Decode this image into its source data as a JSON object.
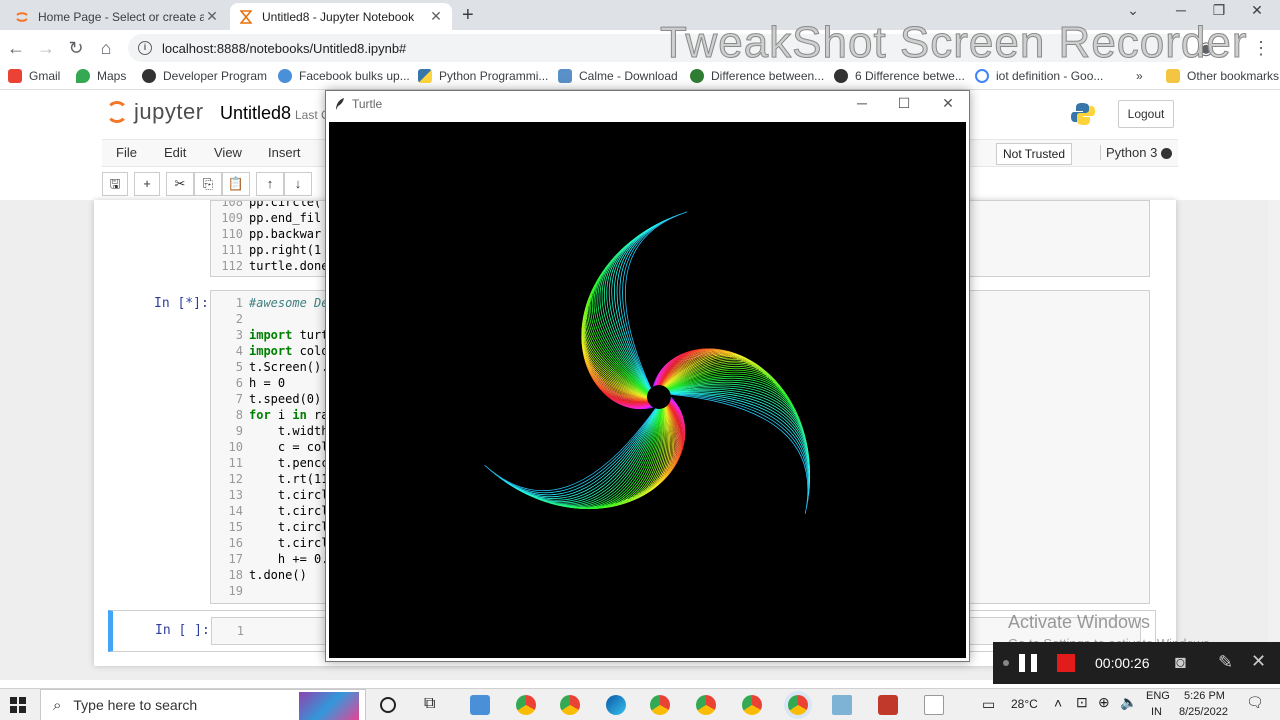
{
  "browser": {
    "tabs": [
      {
        "label": "Home Page - Select or create a n",
        "active": false
      },
      {
        "label": "Untitled8 - Jupyter Notebook",
        "active": true
      }
    ],
    "url": "localhost:8888/notebooks/Untitled8.ipynb#",
    "bookmarks": [
      "Gmail",
      "Maps",
      "Developer Program",
      "Facebook bulks up...",
      "Python Programmi...",
      "Calme - Download",
      "Difference between...",
      "6 Difference betwe...",
      "iot definition - Goo...",
      "»",
      "Other bookmarks"
    ],
    "watermark": "TweakShot Screen Recorder"
  },
  "jupyter": {
    "logo_text": "jupyter",
    "notebook_title": "Untitled8",
    "last_checkpoint": "Last C",
    "logout_label": "Logout",
    "menu": [
      "File",
      "Edit",
      "View",
      "Insert"
    ],
    "not_trusted": "Not Trusted",
    "kernel": "Python 3",
    "cell_top": {
      "lines": [
        {
          "n": "108",
          "code": "pp.circle("
        },
        {
          "n": "109",
          "code": "pp.end_fil"
        },
        {
          "n": "110",
          "code": "pp.backwar"
        },
        {
          "n": "111",
          "code": "pp.right(1"
        },
        {
          "n": "112",
          "code": "turtle.done"
        }
      ]
    },
    "cell_main": {
      "prompt": "In [*]:",
      "lines": [
        {
          "n": "1",
          "code": "#awesome De"
        },
        {
          "n": "2",
          "code": ""
        },
        {
          "n": "3",
          "code": "import turt"
        },
        {
          "n": "4",
          "code": "import colo"
        },
        {
          "n": "5",
          "code": "t.Screen()."
        },
        {
          "n": "6",
          "code": "h = 0"
        },
        {
          "n": "7",
          "code": "t.speed(0)"
        },
        {
          "n": "8",
          "code": "for i in ra"
        },
        {
          "n": "9",
          "code": "    t.width"
        },
        {
          "n": "10",
          "code": "    c = col"
        },
        {
          "n": "11",
          "code": "    t.pencc"
        },
        {
          "n": "12",
          "code": "    t.rt(11"
        },
        {
          "n": "13",
          "code": "    t.circl"
        },
        {
          "n": "14",
          "code": "    t.circl"
        },
        {
          "n": "15",
          "code": "    t.circl"
        },
        {
          "n": "16",
          "code": "    t.circl"
        },
        {
          "n": "17",
          "code": "    h += 0."
        },
        {
          "n": "18",
          "code": "t.done()"
        },
        {
          "n": "19",
          "code": ""
        }
      ]
    },
    "cell_empty": {
      "prompt": "In [ ]:",
      "line": "1"
    }
  },
  "turtle_window": {
    "title": "Turtle"
  },
  "windows_notice": {
    "line1": "Activate Windows",
    "line2": "Go to Settings to activate Windows."
  },
  "recorder": {
    "time": "00:00:26"
  },
  "taskbar": {
    "search_placeholder": "Type here to search",
    "temperature": "28°C",
    "lang1": "ENG",
    "lang2": "IN",
    "time": "5:26 PM",
    "date": "8/25/2022"
  }
}
